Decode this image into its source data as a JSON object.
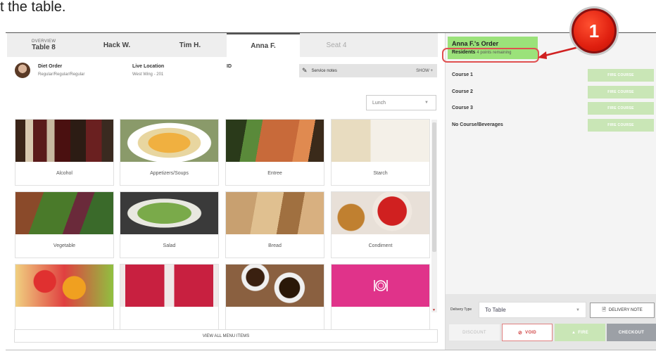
{
  "caption": "t the table.",
  "tabs": [
    {
      "small": "OVERVIEW",
      "label": "Table 8"
    },
    {
      "small": "",
      "label": "Hack W."
    },
    {
      "small": "",
      "label": "Tim H."
    },
    {
      "small": "",
      "label": "Anna F."
    },
    {
      "small": "",
      "label": "Seat 4"
    }
  ],
  "resident": {
    "diet_label": "Diet Order",
    "diet_value": "Regular/Regular/Regular",
    "location_label": "Live Location",
    "location_value": "West Wing - 201",
    "id_label": "ID"
  },
  "service_notes": {
    "label": "Service notes",
    "action": "SHOW +"
  },
  "meal_select": {
    "value": "Lunch"
  },
  "menu_tiles": [
    {
      "label": "Alcohol"
    },
    {
      "label": "Appetizers/Soups"
    },
    {
      "label": "Entree"
    },
    {
      "label": "Starch"
    },
    {
      "label": "Vegetable"
    },
    {
      "label": "Salad"
    },
    {
      "label": "Bread"
    },
    {
      "label": "Condiment"
    },
    {
      "label": ""
    },
    {
      "label": ""
    },
    {
      "label": ""
    },
    {
      "label": ""
    }
  ],
  "view_all": "VIEW ALL MENU ITEMS",
  "order": {
    "title": "Anna F.'s Order",
    "residents_label": "Residents",
    "points": "4 points remaining"
  },
  "courses": [
    {
      "name": "Course 1",
      "button": "FIRE COURSE"
    },
    {
      "name": "Course 2",
      "button": "FIRE COURSE"
    },
    {
      "name": "Course 3",
      "button": "FIRE COURSE"
    },
    {
      "name": "No Course/Beverages",
      "button": "FIRE COURSE"
    }
  ],
  "delivery": {
    "label": "Delivery Type",
    "value": "To Table",
    "note_button": "DELIVERY NOTE"
  },
  "actions": {
    "discount": "DISCOUNT",
    "void": "VOID",
    "fire": "FIRE",
    "checkout": "CHECKOUT"
  },
  "callout_badge": "1",
  "colors": {
    "order_green": "#9be27a",
    "fire_green": "#c9e6b6",
    "callout_red": "#e02010",
    "void_red": "#d04545",
    "checkout_gray": "#9ca0a6",
    "dining_icon_tile": "#e0338a"
  }
}
